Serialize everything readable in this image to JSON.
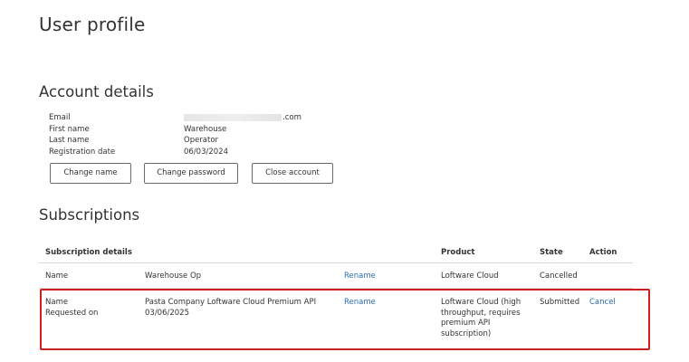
{
  "page": {
    "title": "User profile"
  },
  "account": {
    "title": "Account details",
    "fields": [
      {
        "label": "Email",
        "value": ".com"
      },
      {
        "label": "First name",
        "value": "Warehouse"
      },
      {
        "label": "Last name",
        "value": "Operator"
      },
      {
        "label": "Registration date",
        "value": "06/03/2024"
      }
    ],
    "buttons": {
      "change_name": "Change name",
      "change_password": "Change password",
      "close_account": "Close account"
    }
  },
  "subscriptions": {
    "title": "Subscriptions",
    "headers": {
      "details": "Subscription details",
      "product": "Product",
      "state": "State",
      "action": "Action"
    },
    "rows": [
      {
        "label_1": "Name",
        "label_2": "",
        "value_1": "Warehouse Op",
        "value_2": "",
        "rename": "Rename",
        "product": "Loftware Cloud",
        "state": "Cancelled",
        "action": ""
      },
      {
        "label_1": "Name",
        "label_2": "Requested on",
        "value_1": "Pasta Company Loftware Cloud Premium API",
        "value_2": "03/06/2025",
        "rename": "Rename",
        "product": "Loftware Cloud (high throughput, requires premium API subscription)",
        "state": "Submitted",
        "action": "Cancel"
      }
    ]
  },
  "colors": {
    "link": "#2b6cb0",
    "highlight": "#cc1f1f"
  }
}
